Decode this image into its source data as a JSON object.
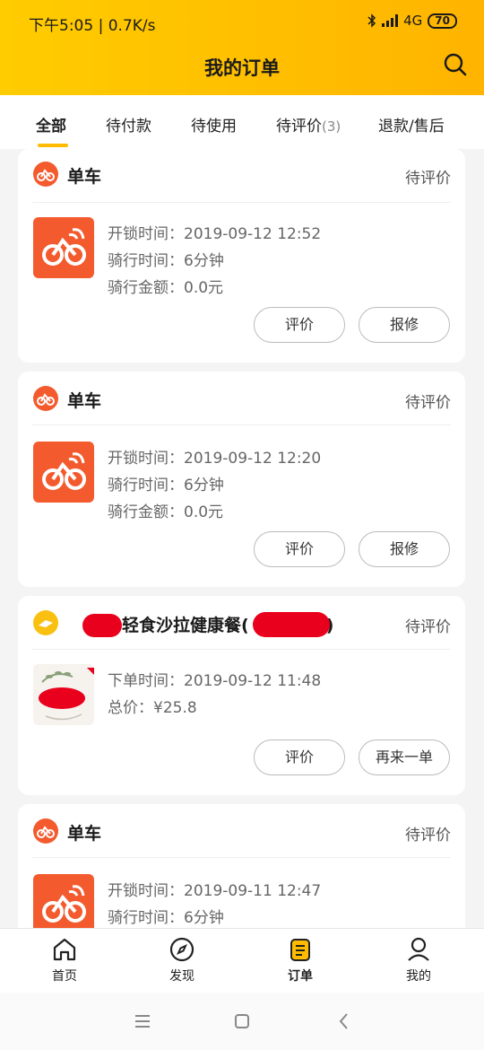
{
  "status_bar": {
    "time": "下午5:05",
    "speed": "0.7K/s",
    "network": "4G",
    "battery": "70"
  },
  "header": {
    "title": "我的订单"
  },
  "tabs": [
    {
      "label": "全部"
    },
    {
      "label": "待付款"
    },
    {
      "label": "待使用"
    },
    {
      "label": "待评价",
      "count": "(3)"
    },
    {
      "label": "退款/售后"
    }
  ],
  "orders": [
    {
      "brand": "单车",
      "status": "待评价",
      "lines": [
        "开锁时间：2019-09-12 12:52",
        "骑行时间：6分钟",
        "骑行金额：0.0元"
      ],
      "buttons": [
        "评价",
        "报修"
      ]
    },
    {
      "brand": "单车",
      "status": "待评价",
      "lines": [
        "开锁时间：2019-09-12 12:20",
        "骑行时间：6分钟",
        "骑行金额：0.0元"
      ],
      "buttons": [
        "评价",
        "报修"
      ]
    },
    {
      "brand_prefix": "(",
      "brand": "轻食沙拉健康餐",
      "brand_paren_open": "(",
      "brand_paren_close": ")",
      "status": "待评价",
      "lines": [
        "下单时间：2019-09-12 11:48",
        "总价：¥25.8"
      ],
      "buttons": [
        "评价",
        "再来一单"
      ]
    },
    {
      "brand": "单车",
      "status": "待评价",
      "lines": [
        "开锁时间：2019-09-11 12:47",
        "骑行时间：6分钟"
      ],
      "buttons": []
    }
  ],
  "bottom_nav": [
    {
      "label": "首页",
      "icon": "home-icon"
    },
    {
      "label": "发现",
      "icon": "compass-icon"
    },
    {
      "label": "订单",
      "icon": "orders-icon",
      "active": true
    },
    {
      "label": "我的",
      "icon": "profile-icon"
    }
  ],
  "colors": {
    "accent": "#ffbb00",
    "bike": "#f35a2d",
    "redaction": "#e8001c"
  }
}
